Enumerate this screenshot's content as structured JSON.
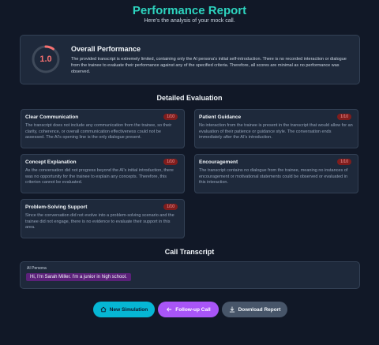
{
  "header": {
    "title": "Performance Report",
    "subtitle": "Here's the analysis of your mock call."
  },
  "overall": {
    "score": "1.0",
    "score_fraction": 0.1,
    "title": "Overall Performance",
    "text": "The provided transcript is extremely limited, containing only the AI persona's initial self-introduction. There is no recorded interaction or dialogue from the trainee to evaluate their performance against any of the specified criteria. Therefore, all scores are minimal as no performance was observed."
  },
  "evaluation": {
    "title": "Detailed Evaluation",
    "cards": [
      {
        "title": "Clear Communication",
        "score": "1/10",
        "text": "The transcript does not include any communication from the trainee, so their clarity, coherence, or overall communication effectiveness could not be assessed. The AI's opening line is the only dialogue present."
      },
      {
        "title": "Patient Guidance",
        "score": "1/10",
        "text": "No interaction from the trainee is present in the transcript that would allow for an evaluation of their patience or guidance style. The conversation ends immediately after the AI's introduction."
      },
      {
        "title": "Concept Explanation",
        "score": "1/10",
        "text": "As the conversation did not progress beyond the AI's initial introduction, there was no opportunity for the trainee to explain any concepts. Therefore, this criterion cannot be evaluated."
      },
      {
        "title": "Encouragement",
        "score": "1/10",
        "text": "The transcript contains no dialogue from the trainee, meaning no instances of encouragement or motivational statements could be observed or evaluated in this interaction."
      },
      {
        "title": "Problem-Solving Support",
        "score": "1/10",
        "text": "Since the conversation did not evolve into a problem-solving scenario and the trainee did not engage, there is no evidence to evaluate their support in this area."
      }
    ]
  },
  "transcript": {
    "title": "Call Transcript",
    "speaker": "AI Persona",
    "message": "Hi, I'm Sarah Miller. I'm a junior in high school."
  },
  "actions": {
    "new_simulation": "New Simulation",
    "follow_up": "Follow-up Call",
    "download": "Download Report"
  },
  "icons": {
    "new_simulation": "home-icon",
    "follow_up": "phone-back-icon",
    "download": "download-icon"
  },
  "colors": {
    "accent": "#2dd4bf",
    "score_red": "#f87171",
    "teal_button": "#06b6d4",
    "purple_button": "#a855f7",
    "gray_button": "#475569",
    "message_bubble": "#5b2179"
  }
}
